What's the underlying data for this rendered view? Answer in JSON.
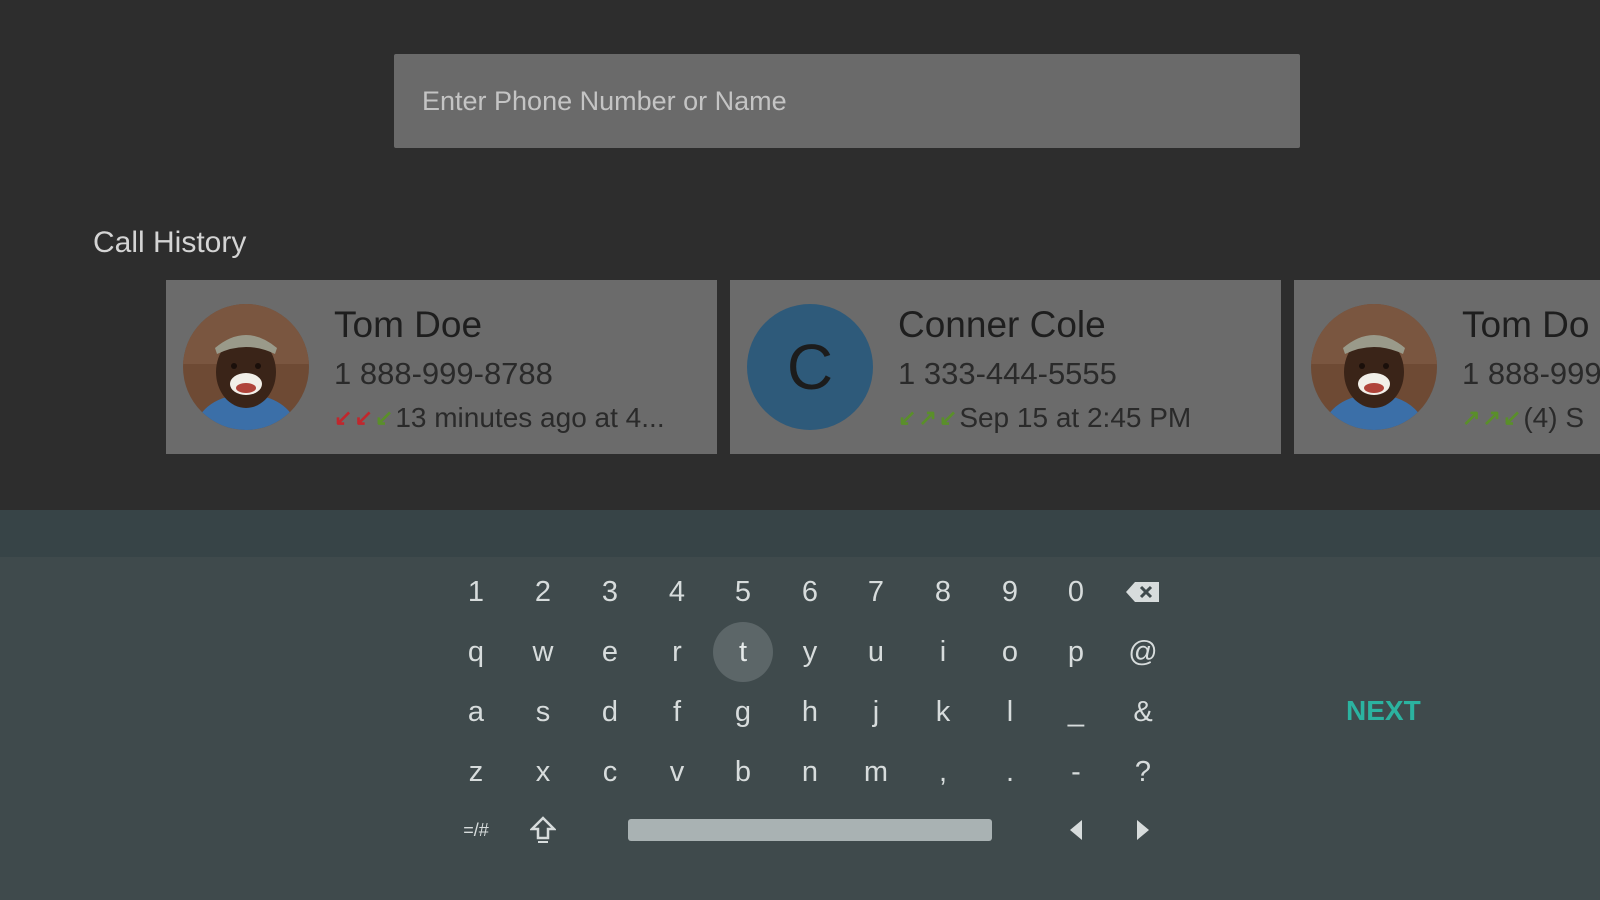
{
  "search": {
    "placeholder": "Enter Phone Number or Name",
    "value": ""
  },
  "call_history": {
    "title": "Call History",
    "entries": [
      {
        "name": "Tom Doe",
        "phone": "1 888-999-8788",
        "detail": "13 minutes ago at 4...",
        "arrows": [
          "missed",
          "missed",
          "in"
        ],
        "avatar": "photo"
      },
      {
        "name": "Conner Cole",
        "phone": "1 333-444-5555",
        "detail": "Sep 15 at 2:45 PM",
        "arrows": [
          "in",
          "out",
          "in"
        ],
        "avatar": "letter",
        "letter": "C"
      },
      {
        "name": "Tom Do",
        "phone": "1 888-999",
        "detail": "(4) S",
        "arrows": [
          "out",
          "out",
          "in"
        ],
        "avatar": "photo"
      }
    ]
  },
  "keyboard": {
    "rows": [
      [
        "1",
        "2",
        "3",
        "4",
        "5",
        "6",
        "7",
        "8",
        "9",
        "0",
        "backspace-icon"
      ],
      [
        "q",
        "w",
        "e",
        "r",
        "t",
        "y",
        "u",
        "i",
        "o",
        "p",
        "@"
      ],
      [
        "a",
        "s",
        "d",
        "f",
        "g",
        "h",
        "j",
        "k",
        "l",
        "_",
        "&"
      ],
      [
        "z",
        "x",
        "c",
        "v",
        "b",
        "n",
        "m",
        ",",
        ".",
        "-",
        "?"
      ]
    ],
    "bottom": {
      "symbols": "=/#",
      "shift": "shift-icon",
      "left": "left-arrow-icon",
      "right": "right-arrow-icon"
    },
    "focused_key": "t",
    "action": "NEXT"
  },
  "colors": {
    "background": "#2d2d2d",
    "card": "#6b6b6b",
    "keyboard": "#3f4a4c",
    "accent": "#2bb3a0",
    "missed": "#c0272d",
    "answered": "#5a8f2a"
  }
}
